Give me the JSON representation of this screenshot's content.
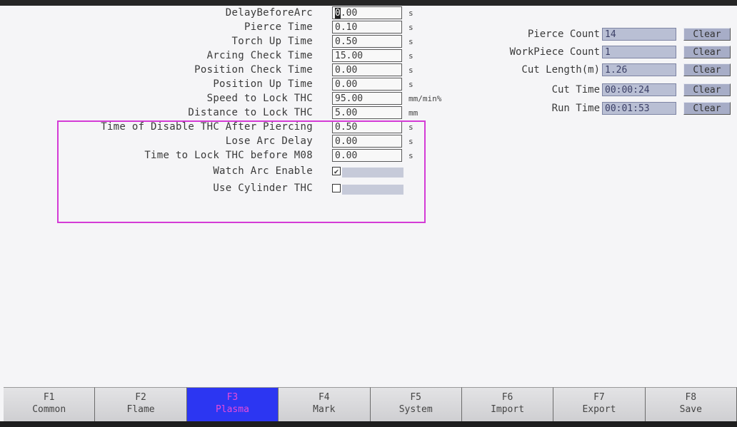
{
  "params": [
    {
      "label": "DelayBeforeArc",
      "cursor_char": "0",
      "value_rest": ".00",
      "unit": "s"
    },
    {
      "label": "Pierce Time",
      "value": "0.10",
      "unit": "s"
    },
    {
      "label": "Torch Up Time",
      "value": "0.50",
      "unit": "s"
    },
    {
      "label": "Arcing Check Time",
      "value": "15.00",
      "unit": "s"
    },
    {
      "label": "Position Check Time",
      "value": "0.00",
      "unit": "s"
    },
    {
      "label": "Position Up Time",
      "value": "0.00",
      "unit": "s"
    },
    {
      "label": "Speed to Lock THC",
      "value": "95.00",
      "unit": "mm/min%"
    },
    {
      "label": "Distance to Lock THC",
      "value": "5.00",
      "unit": "mm"
    },
    {
      "label": "Time of Disable THC After Piercing",
      "value": "0.50",
      "unit": "s"
    },
    {
      "label": "Lose Arc Delay",
      "value": "0.00",
      "unit": "s"
    },
    {
      "label": "Time to Lock THC before M08",
      "value": "0.00",
      "unit": "s"
    }
  ],
  "checkboxes": [
    {
      "label": "Watch Arc Enable",
      "checked": true,
      "mark": "✔"
    },
    {
      "label": "Use Cylinder THC",
      "checked": false,
      "mark": ""
    }
  ],
  "stats": [
    {
      "label": "Pierce Count",
      "value": "14",
      "button": "Clear"
    },
    {
      "label": "WorkPiece Count",
      "value": "1",
      "button": "Clear"
    },
    {
      "label": "Cut Length(m)",
      "value": "1.26",
      "button": "Clear"
    },
    {
      "label": "Cut Time",
      "value": "00:00:24",
      "button": "Clear"
    },
    {
      "label": "Run Time",
      "value": "00:01:53",
      "button": "Clear"
    }
  ],
  "fkeys": [
    {
      "key": "F1",
      "name": "Common",
      "active": false
    },
    {
      "key": "F2",
      "name": "Flame",
      "active": false
    },
    {
      "key": "F3",
      "name": "Plasma",
      "active": true
    },
    {
      "key": "F4",
      "name": "Mark",
      "active": false
    },
    {
      "key": "F5",
      "name": "System",
      "active": false
    },
    {
      "key": "F6",
      "name": "Import",
      "active": false
    },
    {
      "key": "F7",
      "name": "Export",
      "active": false
    },
    {
      "key": "F8",
      "name": "Save",
      "active": false
    }
  ],
  "colors": {
    "highlight": "#d43bd6",
    "active_tab": "#2c36f2",
    "active_tab_text": "#e64bd9",
    "stat_field": "#b9bfd4"
  }
}
